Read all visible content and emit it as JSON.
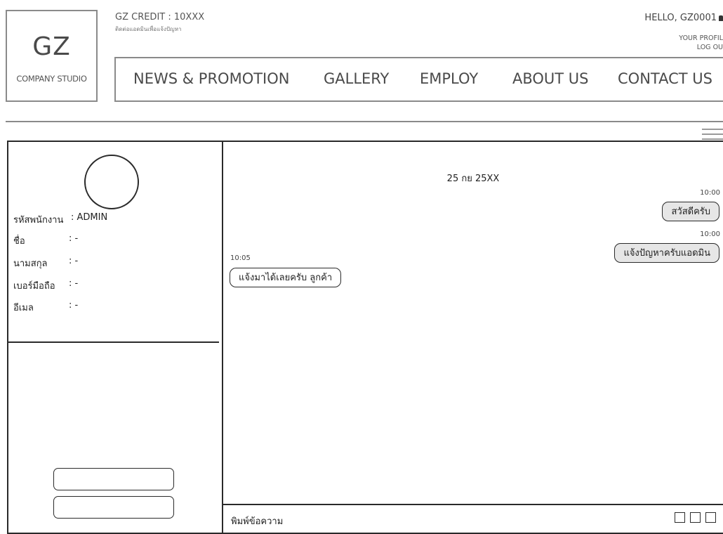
{
  "brand": {
    "logo_text": "GZ",
    "logo_subtext": "COMPANY STUDIO"
  },
  "account": {
    "credit_label": "GZ CREDIT : 10XXX",
    "credit_subtext": "ติดต่อแอดมินเพื่อแจ้งปัญหา",
    "greeting": "HELLO, GZ0001",
    "profile_link": "YOUR PROFIL",
    "logout_link": "LOG OU"
  },
  "nav": {
    "items": [
      "NEWS & PROMOTION",
      "GALLERY",
      "EMPLOY",
      "ABOUT US",
      "CONTACT US"
    ]
  },
  "profile": {
    "fields": [
      {
        "label": "รหัสพนักงาน",
        "value": ": ADMIN"
      },
      {
        "label": "ชื่อ",
        "value": ": -"
      },
      {
        "label": "นามสกุล",
        "value": ": -"
      },
      {
        "label": "เบอร์มือถือ",
        "value": ": -"
      },
      {
        "label": "อีเมล",
        "value": ": -"
      }
    ]
  },
  "chat": {
    "date": "25 กย 25XX",
    "messages": [
      {
        "direction": "out",
        "time": "10:00",
        "text": "สวัสดีครับ"
      },
      {
        "direction": "out",
        "time": "10:00",
        "text": "แจ้งปัญหาครับแอดมิน"
      },
      {
        "direction": "in",
        "time": "10:05",
        "text": "แจ้งมาได้เลยครับ ลูกค้า"
      }
    ],
    "input_placeholder": "พิมพ์ข้อความ"
  },
  "icons": {
    "lock": "lock-icon",
    "menu": "hamburger-icon",
    "actions": [
      "square-icon",
      "square-icon",
      "square-icon"
    ]
  }
}
